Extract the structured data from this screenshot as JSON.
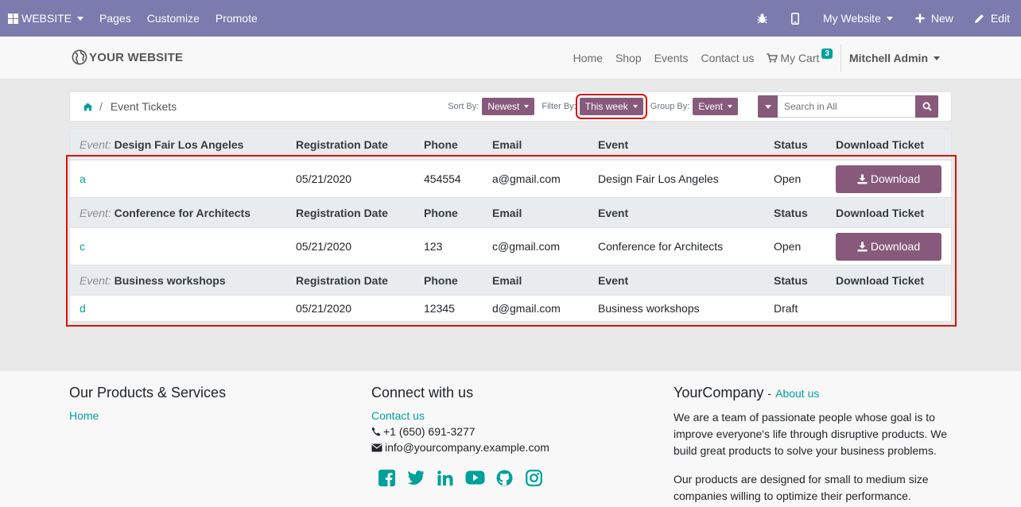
{
  "adminbar": {
    "website": "WEBSITE",
    "pages": "Pages",
    "customize": "Customize",
    "promote": "Promote",
    "my_website": "My Website",
    "new": "New",
    "edit": "Edit"
  },
  "header": {
    "logo": "YOUR WEBSITE",
    "nav": [
      "Home",
      "Shop",
      "Events",
      "Contact us"
    ],
    "cart_label": "My Cart",
    "cart_count": "3",
    "user": "Mitchell Admin"
  },
  "toolbar": {
    "breadcrumb": "Event Tickets",
    "sort_label": "Sort By:",
    "sort_value": "Newest",
    "filter_label": "Filter By:",
    "filter_value": "This week",
    "group_label": "Group By:",
    "group_value": "Event",
    "search_placeholder": "Search in All"
  },
  "table": {
    "event_prefix": "Event:",
    "columns": {
      "reg_date": "Registration Date",
      "phone": "Phone",
      "email": "Email",
      "event": "Event",
      "status": "Status",
      "download": "Download Ticket"
    },
    "download_label": "Download",
    "groups": [
      {
        "event": "Design Fair Los Angeles",
        "row": {
          "name": "a",
          "date": "05/21/2020",
          "phone": "454554",
          "email": "a@gmail.com",
          "event": "Design Fair Los Angeles",
          "status": "Open"
        }
      },
      {
        "event": "Conference for Architects",
        "row": {
          "name": "c",
          "date": "05/21/2020",
          "phone": "123",
          "email": "c@gmail.com",
          "event": "Conference for Architects",
          "status": "Open"
        }
      },
      {
        "event": "Business workshops",
        "row": {
          "name": "d",
          "date": "05/21/2020",
          "phone": "12345",
          "email": "d@gmail.com",
          "event": "Business workshops",
          "status": "Draft"
        }
      }
    ]
  },
  "footer": {
    "products_title": "Our Products & Services",
    "home_link": "Home",
    "connect_title": "Connect with us",
    "contact_link": "Contact us",
    "phone": "+1 (650) 691-3277",
    "email": "info@yourcompany.example.com",
    "company_name": "YourCompany",
    "company_dash": "-",
    "about_link": "About us",
    "para1": "We are a team of passionate people whose goal is to improve everyone's life through disruptive products. We build great products to solve your business problems.",
    "para2": "Our products are designed for small to medium size companies willing to optimize their performance."
  },
  "colors": {
    "admin_bar": "#7c7bad",
    "primary": "#875a7b",
    "link": "#00a09d",
    "highlight": "#d9140c"
  }
}
